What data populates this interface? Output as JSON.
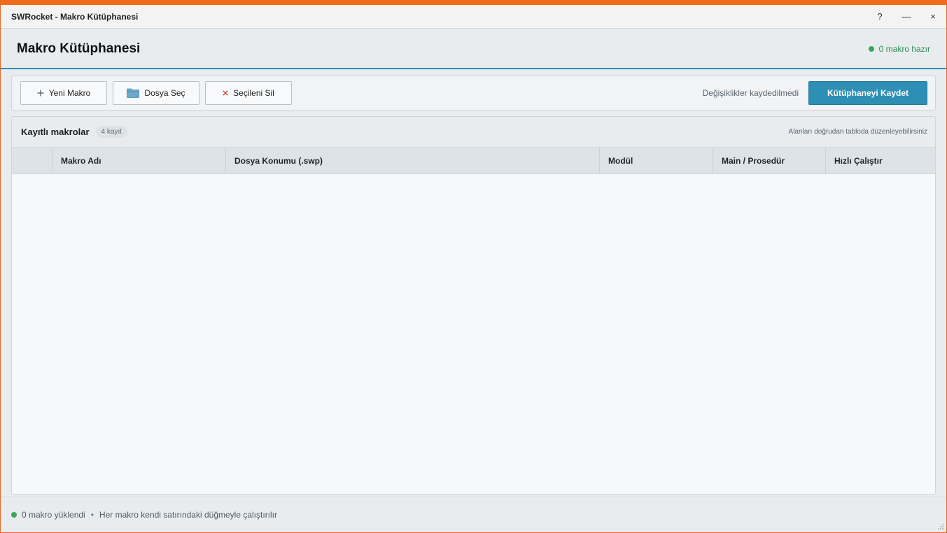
{
  "window": {
    "title": "SWRocket - Makro Kütüphanesi",
    "help_label": "?",
    "minimize_label": "—",
    "close_label": "×"
  },
  "header": {
    "title": "Makro Kütüphanesi",
    "status": "0 makro hazır"
  },
  "toolbar": {
    "new_label": "Yeni Makro",
    "file_label": "Dosya Seç",
    "delete_label": "Seçileni Sil",
    "unsaved_text": "Değişiklikler kaydedilmedi",
    "save_label": "Kütüphaneyi Kaydet"
  },
  "table": {
    "title": "Kayıtlı makrolar",
    "badge": "4 kayıt",
    "hint": "Alanları doğrudan tabloda düzenleyebilirsiniz",
    "columns": [
      "",
      "Makro Adı",
      "Dosya Konumu (.swp)",
      "Modül",
      "Main / Prosedür",
      "Hızlı Çalıştır"
    ],
    "rows": []
  },
  "footer": {
    "loaded": "0 makro yüklendi",
    "separator": "•",
    "info": "Her makro kendi satırındaki düğmeyle çalıştırılır"
  },
  "colors": {
    "accent": "#2e8fb5",
    "window_border": "#f26a1b",
    "status_green": "#3aa65c",
    "delete_red": "#d9342b"
  },
  "icons": {
    "new": "plus-icon",
    "file": "folder-icon",
    "delete": "x-icon",
    "status": "status-dot-icon"
  }
}
